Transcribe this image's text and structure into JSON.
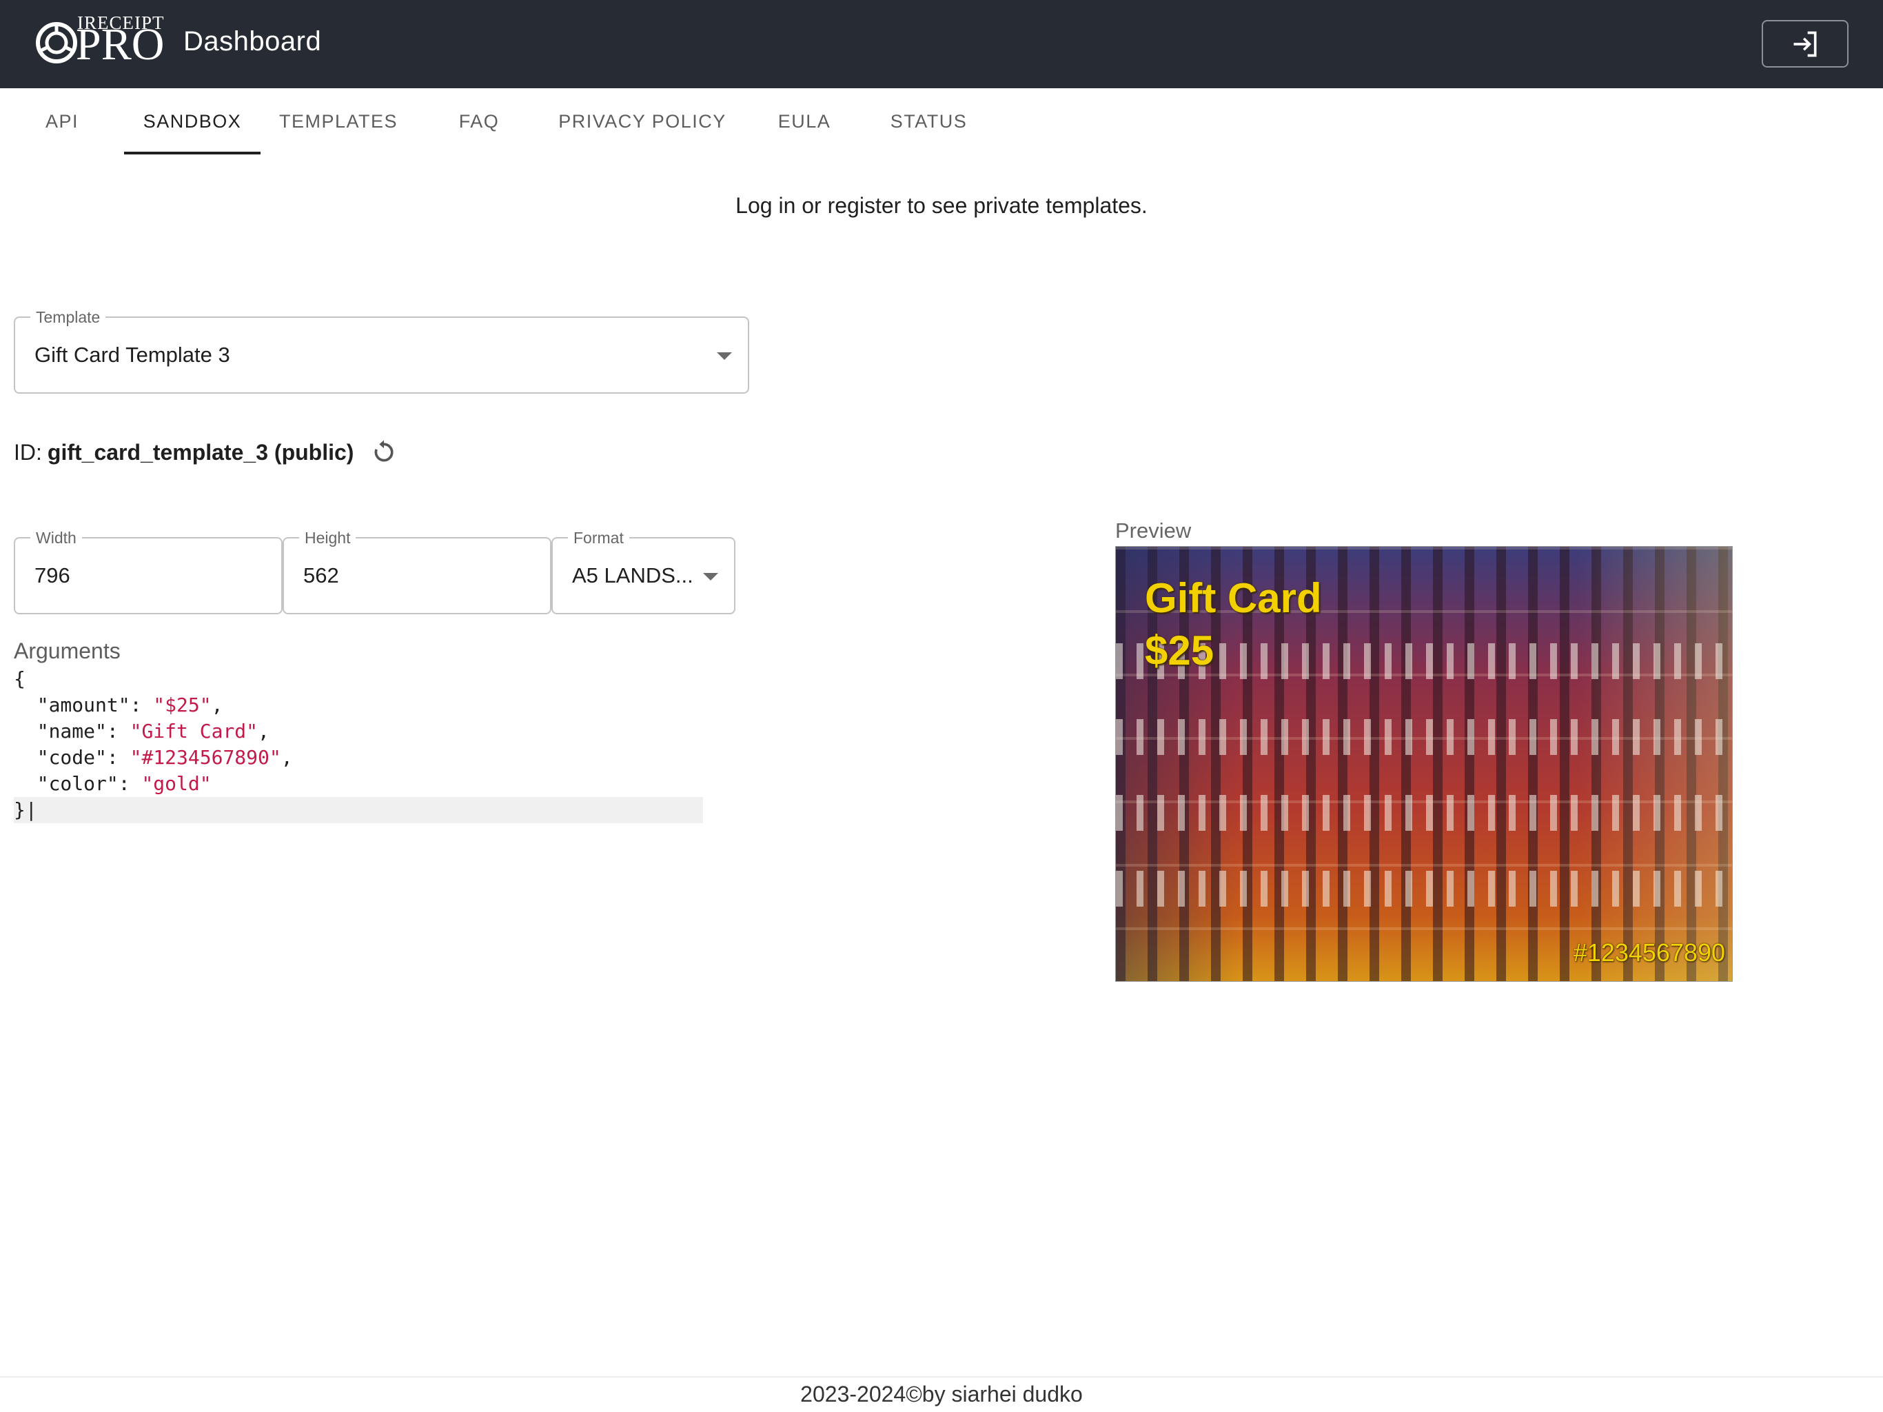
{
  "header": {
    "logo_small": "IRECEIPT",
    "logo_big": "PRO",
    "title": "Dashboard"
  },
  "tabs": [
    {
      "label": "API"
    },
    {
      "label": "SANDBOX"
    },
    {
      "label": "TEMPLATES"
    },
    {
      "label": "FAQ"
    },
    {
      "label": "PRIVACY POLICY"
    },
    {
      "label": "EULA"
    },
    {
      "label": "STATUS"
    }
  ],
  "active_tab": "SANDBOX",
  "notice": "Log in or register to see private templates.",
  "template_select": {
    "label": "Template",
    "value": "Gift Card Template 3"
  },
  "id_row": {
    "prefix": "ID:",
    "id": "gift_card_template_3 (public)"
  },
  "dimensions": {
    "width_label": "Width",
    "width_value": "796",
    "height_label": "Height",
    "height_value": "562",
    "format_label": "Format",
    "format_value": "A5 LANDS..."
  },
  "arguments": {
    "label": "Arguments",
    "lines": [
      {
        "key": "",
        "value": "",
        "text": "{"
      },
      {
        "key": "\"amount\"",
        "value": "\"$25\"",
        "sep": ","
      },
      {
        "key": "\"name\"",
        "value": "\"Gift Card\"",
        "sep": ","
      },
      {
        "key": "\"code\"",
        "value": "\"#1234567890\"",
        "sep": ","
      },
      {
        "key": "\"color\"",
        "value": "\"gold\"",
        "sep": ""
      },
      {
        "key": "",
        "value": "",
        "text": "}"
      }
    ]
  },
  "preview": {
    "label": "Preview",
    "title": "Gift Card",
    "amount": "$25",
    "code": "#1234567890"
  },
  "footer": "2023-2024©by siarhei dudko",
  "colors": {
    "appbar": "#272b33",
    "accent_gold": "#f3d100",
    "code_string": "#c41a4a"
  },
  "icons": {
    "login": "login-icon",
    "refresh": "refresh-icon",
    "dropdown": "chevron-down-icon"
  }
}
